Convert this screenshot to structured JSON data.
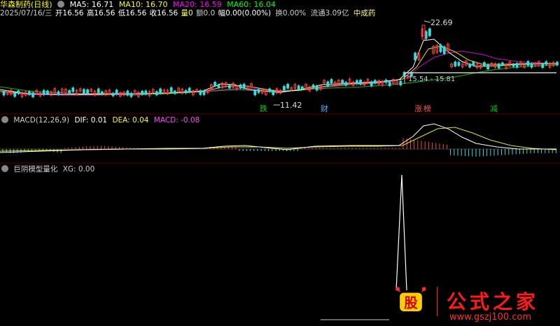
{
  "main_panel": {
    "stock_name": "华森制药(日线)",
    "ma": [
      {
        "label": "MA5: 16.71",
        "color": "#ffffff"
      },
      {
        "label": "MA10: 16.70",
        "color": "#ffff00"
      },
      {
        "label": "MA20: 16.59",
        "color": "#ff00ff"
      },
      {
        "label": "MA60: 16.04",
        "color": "#00ff00"
      }
    ],
    "quote": {
      "date": "2025/07/16/三",
      "open": "开16.56",
      "high": "高16.56",
      "low": "低16.56",
      "close": "收16.56",
      "volume": "量0",
      "amount": "额0.0",
      "change": "幅0.00(0.00%)",
      "turnover": "换0.00%",
      "float": "流通3.09亿",
      "sector": "中成药"
    },
    "annotations": {
      "high_price": "22.69",
      "low_price": "11.42",
      "range": "15.54 - 15.81"
    },
    "event_labels": [
      {
        "text": "跌",
        "color": "#00cc00"
      },
      {
        "text": "财",
        "color": "#4db8ff"
      },
      {
        "text": "涨",
        "color": "#ff5555"
      },
      {
        "text": "榜",
        "color": "#ff5555"
      },
      {
        "text": "减",
        "color": "#00cc00"
      }
    ]
  },
  "macd_panel": {
    "title": "MACD(12,26,9)",
    "dif": "DIF: 0.01",
    "dea": "DEA: 0.04",
    "macd": "MACD: -0.08"
  },
  "indicator_panel": {
    "title": "巨阴模型量化",
    "xg": "XG: 0.00"
  },
  "watermark": {
    "logo_char": "股",
    "title": "公式之家",
    "url": "www.gszj100.com"
  }
}
